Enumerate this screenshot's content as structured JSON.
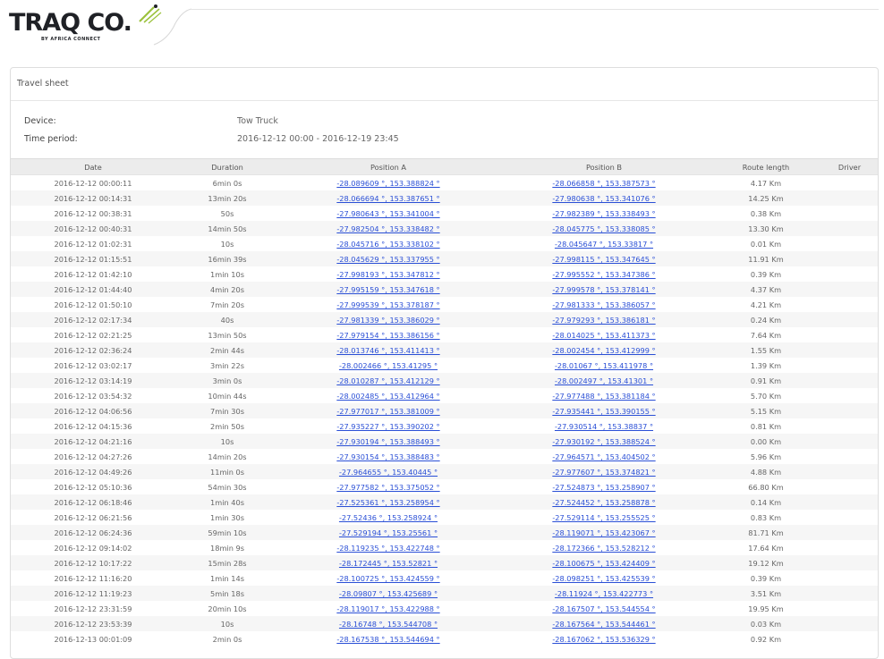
{
  "brand": {
    "name": "TRAQ CO.",
    "sub": "BY AFRICA CONNECT"
  },
  "panel": {
    "title": "Travel sheet"
  },
  "info": {
    "device_label": "Device:",
    "device_value": "Tow Truck",
    "period_label": "Time period:",
    "period_value": "2016-12-12 00:00 - 2016-12-19 23:45"
  },
  "table": {
    "headers": [
      "Date",
      "Duration",
      "Position A",
      "Position B",
      "Route length",
      "Driver"
    ],
    "rows": [
      [
        "2016-12-12 00:00:11",
        "6min 0s",
        "-28.089609 °, 153.388824 °",
        "-28.066858 °, 153.387573 °",
        "4.17 Km",
        ""
      ],
      [
        "2016-12-12 00:14:31",
        "13min 20s",
        "-28.066694 °, 153.387651 °",
        "-27.980638 °, 153.341076 °",
        "14.25 Km",
        ""
      ],
      [
        "2016-12-12 00:38:31",
        "50s",
        "-27.980643 °, 153.341004 °",
        "-27.982389 °, 153.338493 °",
        "0.38 Km",
        ""
      ],
      [
        "2016-12-12 00:40:31",
        "14min 50s",
        "-27.982504 °, 153.338482 °",
        "-28.045775 °, 153.338085 °",
        "13.30 Km",
        ""
      ],
      [
        "2016-12-12 01:02:31",
        "10s",
        "-28.045716 °, 153.338102 °",
        "-28.045647 °, 153.33817 °",
        "0.01 Km",
        ""
      ],
      [
        "2016-12-12 01:15:51",
        "16min 39s",
        "-28.045629 °, 153.337955 °",
        "-27.998115 °, 153.347645 °",
        "11.91 Km",
        ""
      ],
      [
        "2016-12-12 01:42:10",
        "1min 10s",
        "-27.998193 °, 153.347812 °",
        "-27.995552 °, 153.347386 °",
        "0.39 Km",
        ""
      ],
      [
        "2016-12-12 01:44:40",
        "4min 20s",
        "-27.995159 °, 153.347618 °",
        "-27.999578 °, 153.378141 °",
        "4.37 Km",
        ""
      ],
      [
        "2016-12-12 01:50:10",
        "7min 20s",
        "-27.999539 °, 153.378187 °",
        "-27.981333 °, 153.386057 °",
        "4.21 Km",
        ""
      ],
      [
        "2016-12-12 02:17:34",
        "40s",
        "-27.981339 °, 153.386029 °",
        "-27.979293 °, 153.386181 °",
        "0.24 Km",
        ""
      ],
      [
        "2016-12-12 02:21:25",
        "13min 50s",
        "-27.979154 °, 153.386156 °",
        "-28.014025 °, 153.411373 °",
        "7.64 Km",
        ""
      ],
      [
        "2016-12-12 02:36:24",
        "2min 44s",
        "-28.013746 °, 153.411413 °",
        "-28.002454 °, 153.412999 °",
        "1.55 Km",
        ""
      ],
      [
        "2016-12-12 03:02:17",
        "3min 22s",
        "-28.002466 °, 153.41295 °",
        "-28.01067 °, 153.411978 °",
        "1.39 Km",
        ""
      ],
      [
        "2016-12-12 03:14:19",
        "3min 0s",
        "-28.010287 °, 153.412129 °",
        "-28.002497 °, 153.41301 °",
        "0.91 Km",
        ""
      ],
      [
        "2016-12-12 03:54:32",
        "10min 44s",
        "-28.002485 °, 153.412964 °",
        "-27.977488 °, 153.381184 °",
        "5.70 Km",
        ""
      ],
      [
        "2016-12-12 04:06:56",
        "7min 30s",
        "-27.977017 °, 153.381009 °",
        "-27.935441 °, 153.390155 °",
        "5.15 Km",
        ""
      ],
      [
        "2016-12-12 04:15:36",
        "2min 50s",
        "-27.935227 °, 153.390202 °",
        "-27.930514 °, 153.38837 °",
        "0.81 Km",
        ""
      ],
      [
        "2016-12-12 04:21:16",
        "10s",
        "-27.930194 °, 153.388493 °",
        "-27.930192 °, 153.388524 °",
        "0.00 Km",
        ""
      ],
      [
        "2016-12-12 04:27:26",
        "14min 20s",
        "-27.930154 °, 153.388483 °",
        "-27.964571 °, 153.404502 °",
        "5.96 Km",
        ""
      ],
      [
        "2016-12-12 04:49:26",
        "11min 0s",
        "-27.964655 °, 153.40445 °",
        "-27.977607 °, 153.374821 °",
        "4.88 Km",
        ""
      ],
      [
        "2016-12-12 05:10:36",
        "54min 30s",
        "-27.977582 °, 153.375052 °",
        "-27.524873 °, 153.258907 °",
        "66.80 Km",
        ""
      ],
      [
        "2016-12-12 06:18:46",
        "1min 40s",
        "-27.525361 °, 153.258954 °",
        "-27.524452 °, 153.258878 °",
        "0.14 Km",
        ""
      ],
      [
        "2016-12-12 06:21:56",
        "1min 30s",
        "-27.52436 °, 153.258924 °",
        "-27.529114 °, 153.255525 °",
        "0.83 Km",
        ""
      ],
      [
        "2016-12-12 06:24:36",
        "59min 10s",
        "-27.529194 °, 153.25561 °",
        "-28.119071 °, 153.423067 °",
        "81.71 Km",
        ""
      ],
      [
        "2016-12-12 09:14:02",
        "18min 9s",
        "-28.119235 °, 153.422748 °",
        "-28.172366 °, 153.528212 °",
        "17.64 Km",
        ""
      ],
      [
        "2016-12-12 10:17:22",
        "15min 28s",
        "-28.172445 °, 153.52821 °",
        "-28.100675 °, 153.424409 °",
        "19.12 Km",
        ""
      ],
      [
        "2016-12-12 11:16:20",
        "1min 14s",
        "-28.100725 °, 153.424559 °",
        "-28.098251 °, 153.425539 °",
        "0.39 Km",
        ""
      ],
      [
        "2016-12-12 11:19:23",
        "5min 18s",
        "-28.09807 °, 153.425689 °",
        "-28.11924 °, 153.422773 °",
        "3.51 Km",
        ""
      ],
      [
        "2016-12-12 23:31:59",
        "20min 10s",
        "-28.119017 °, 153.422988 °",
        "-28.167507 °, 153.544554 °",
        "19.95 Km",
        ""
      ],
      [
        "2016-12-12 23:53:39",
        "10s",
        "-28.16748 °, 153.544708 °",
        "-28.167564 °, 153.544461 °",
        "0.03 Km",
        ""
      ],
      [
        "2016-12-13 00:01:09",
        "2min 0s",
        "-28.167538 °, 153.544694 °",
        "-28.167062 °, 153.536329 °",
        "0.92 Km",
        ""
      ]
    ]
  }
}
